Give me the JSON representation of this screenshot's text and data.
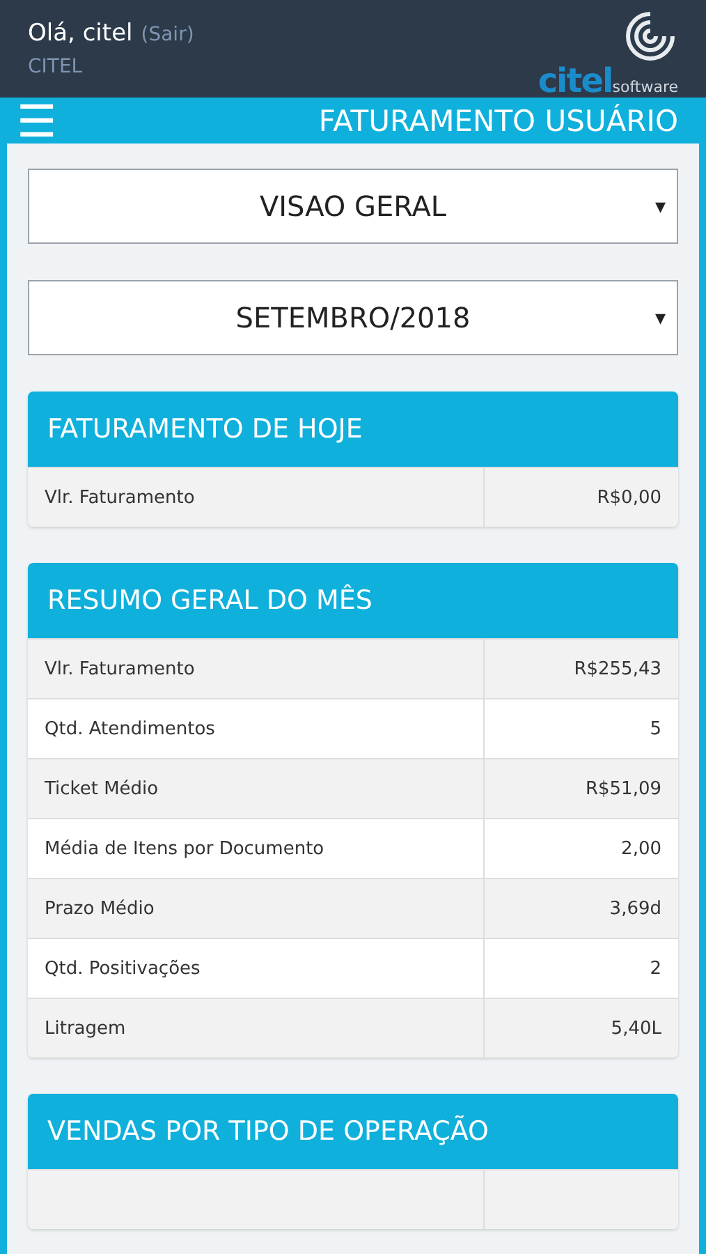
{
  "header": {
    "greeting": "Olá, citel",
    "logout_link": "(Sair)",
    "company": "CITEL",
    "logo": {
      "brand": "citel",
      "suffix": "software"
    }
  },
  "navbar": {
    "menu_icon": "☰",
    "title": "FATURAMENTO USUÁRIO"
  },
  "selects": [
    {
      "value": "VISAO GERAL",
      "caret": "▾"
    },
    {
      "value": "SETEMBRO/2018",
      "caret": "▾"
    }
  ],
  "cards": [
    {
      "title": "FATURAMENTO DE HOJE",
      "rows": [
        {
          "label": "Vlr. Faturamento",
          "value": "R$0,00"
        }
      ]
    },
    {
      "title": "RESUMO GERAL DO MÊS",
      "rows": [
        {
          "label": "Vlr. Faturamento",
          "value": "R$255,43"
        },
        {
          "label": "Qtd. Atendimentos",
          "value": "5"
        },
        {
          "label": "Ticket Médio",
          "value": "R$51,09"
        },
        {
          "label": "Média de Itens por Documento",
          "value": "2,00"
        },
        {
          "label": "Prazo Médio",
          "value": "3,69d"
        },
        {
          "label": "Qtd. Positivações",
          "value": "2"
        },
        {
          "label": "Litragem",
          "value": "5,40L"
        }
      ]
    },
    {
      "title": "VENDAS POR TIPO DE OPERAÇÃO"
    }
  ]
}
